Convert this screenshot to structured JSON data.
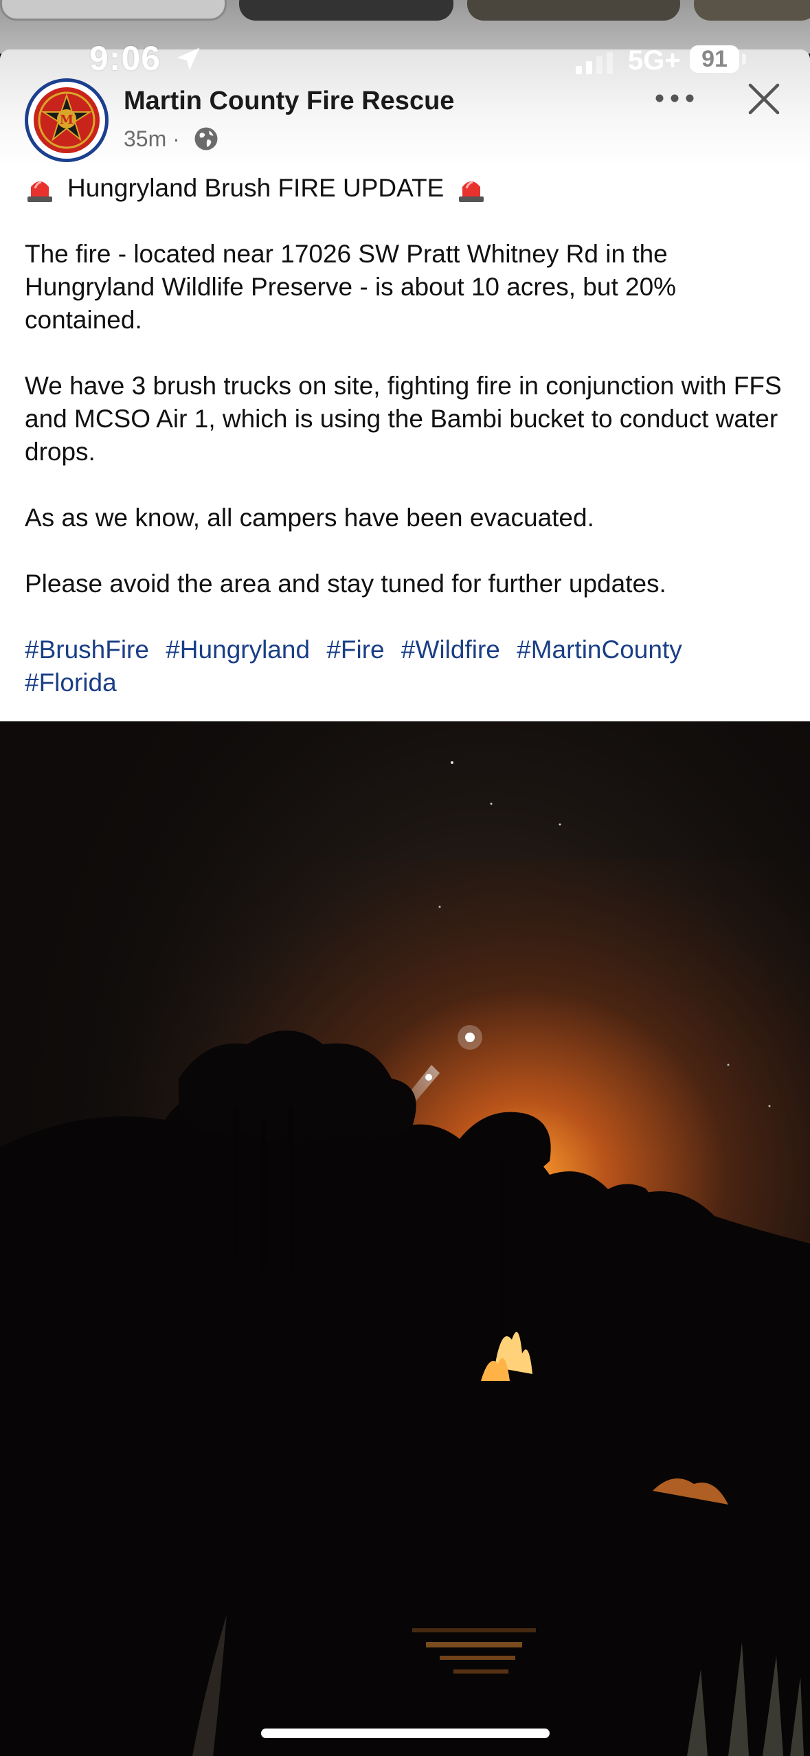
{
  "status_bar": {
    "time": "9:06",
    "network": "5G+",
    "battery": "91"
  },
  "post": {
    "page_name": "Martin County Fire Rescue",
    "time_ago": "35m",
    "headline": "Hungryland Brush FIRE UPDATE",
    "paragraphs": [
      "The fire - located near 17026 SW Pratt Whitney Rd in the Hungryland Wildlife Preserve - is about 10 acres, but 20% contained.",
      "We have 3 brush trucks on site, fighting fire in conjunction with FFS and MCSO Air 1, which is using the Bambi bucket to conduct water drops.",
      "As as we know, all campers have been evacuated.",
      "Please avoid the area and stay tuned for further updates."
    ],
    "hashtags": [
      "#BrushFire",
      "#Hungryland",
      "#Fire",
      "#Wildfire",
      "#MartinCounty",
      "#Florida"
    ]
  },
  "icons": {
    "location": "location-arrow-icon",
    "globe": "globe-icon",
    "more": "more-icon",
    "close": "close-icon",
    "siren": "siren-icon"
  },
  "colors": {
    "hashtag": "#1a3f86",
    "avatar_ring": "#1c3f8f",
    "logo_red": "#c8241c",
    "logo_gold": "#d9a62a"
  }
}
